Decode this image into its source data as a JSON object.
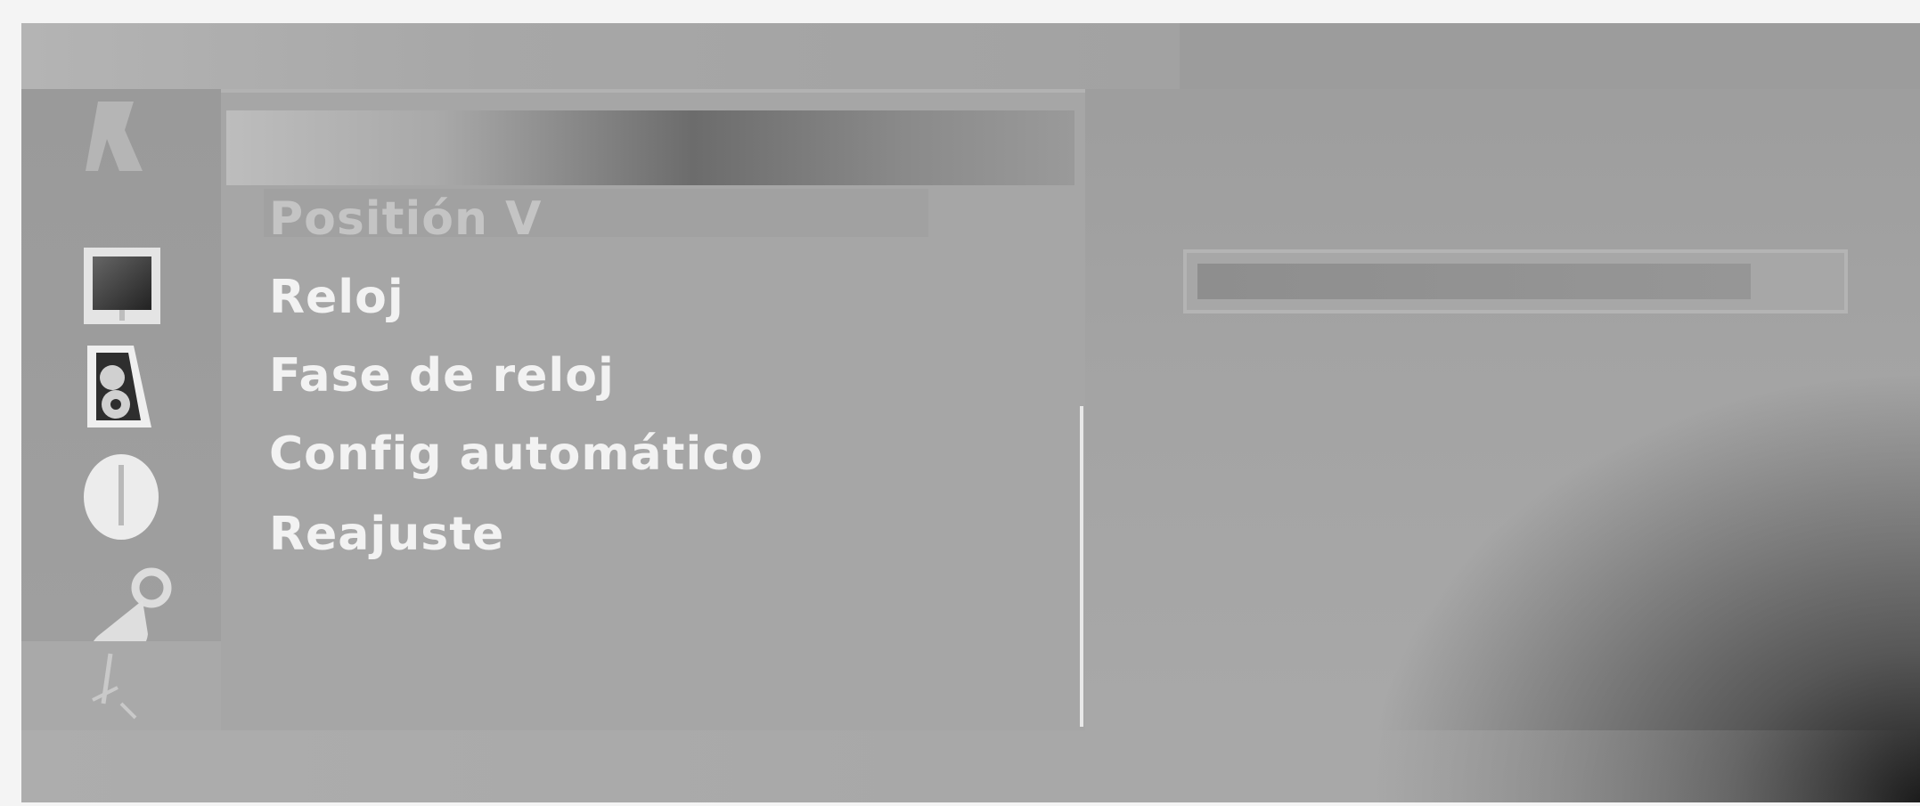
{
  "sidebar": {
    "icons": [
      {
        "name": "picture-icon"
      },
      {
        "name": "screen-icon"
      },
      {
        "name": "audio-icon"
      },
      {
        "name": "info-icon"
      },
      {
        "name": "setup-icon"
      },
      {
        "name": "selected-icon"
      }
    ]
  },
  "menu": {
    "highlighted_label": "",
    "items": [
      {
        "label": "Positión V",
        "state": "dim"
      },
      {
        "label": "Reloj",
        "state": "normal"
      },
      {
        "label": "Fase de reloj",
        "state": "normal"
      },
      {
        "label": "Config automático",
        "state": "normal"
      },
      {
        "label": "Reajuste",
        "state": "normal"
      }
    ]
  },
  "slider": {
    "value_fraction": 0.87
  },
  "colors": {
    "text": "#f2f2f2",
    "panel": "#a6a6a6",
    "highlight_dark": "#6c6c6c",
    "corner_dark": "#141414"
  }
}
